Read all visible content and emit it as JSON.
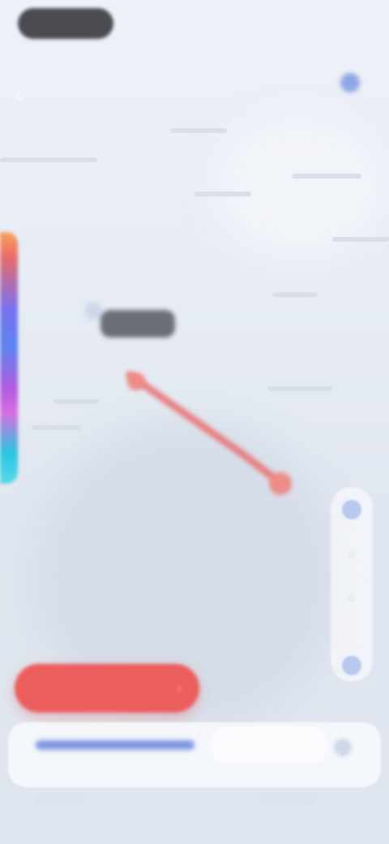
{
  "status_bar": {
    "time": ""
  },
  "top_tabs": [
    {
      "label": ""
    },
    {
      "label": ""
    }
  ],
  "header": {
    "back_icon": "back-icon",
    "account_icon": "account-icon"
  },
  "map": {
    "tag_label": "",
    "route_color": "#e96d6d",
    "rail_colors": [
      "#f7a25b",
      "#7d70ee",
      "#5b84f0",
      "#b15be0",
      "#27c7e2"
    ]
  },
  "map_controls": {
    "icons": [
      "locate-icon",
      "layers-icon",
      "compass-icon",
      "zoom-icon"
    ]
  },
  "cta": {
    "label": "",
    "color": "#ec5d5d",
    "chevron_icon": "chevron-right-icon"
  },
  "bottom_panel": {
    "link_text": "",
    "field_value": "",
    "link_color": "#7f98e4"
  },
  "colors": {
    "background": "#e9eef6",
    "accent": "#8ea8e5"
  }
}
